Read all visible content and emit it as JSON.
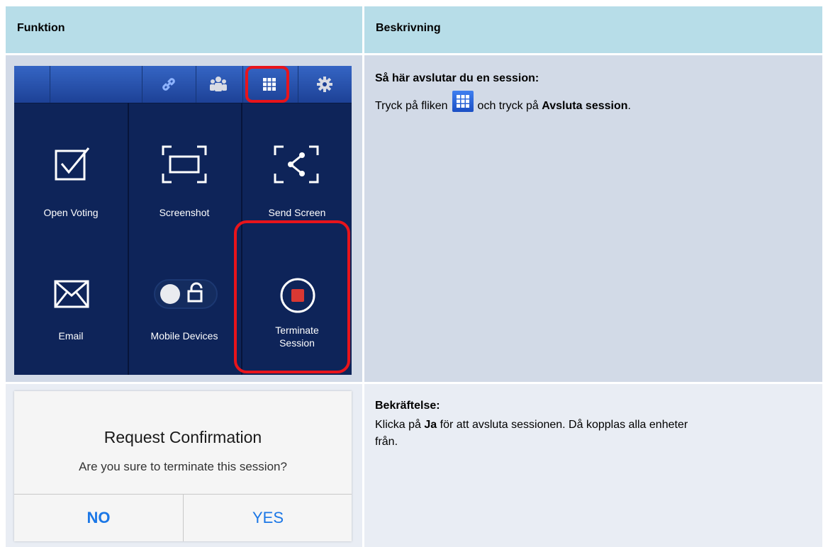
{
  "table": {
    "header": {
      "col1": "Funktion",
      "col2": "Beskrivning"
    }
  },
  "row1": {
    "menu": {
      "toolbar_icons": [
        "link-icon",
        "people-icon",
        "grid-icon",
        "gear-icon"
      ],
      "tiles": [
        {
          "label": "Open Voting",
          "icon": "checkbox-icon"
        },
        {
          "label": "Screenshot",
          "icon": "screenshot-icon"
        },
        {
          "label": "Send Screen",
          "icon": "share-icon"
        },
        {
          "label": "Email",
          "icon": "envelope-icon"
        },
        {
          "label": "Mobile Devices",
          "icon": "toggle-lock-icon"
        },
        {
          "label_line1": "Terminate",
          "label_line2": "Session",
          "icon": "stop-icon"
        }
      ],
      "highlight_color": "#e8141b"
    },
    "heading": "Så här avslutar du en session:",
    "text_before": "Tryck på fliken",
    "text_middle": "och tryck på",
    "text_bold": "Avsluta session",
    "text_end": "."
  },
  "row2": {
    "dialog": {
      "title": "Request Confirmation",
      "message": "Are you sure to terminate this session?",
      "no_label": "NO",
      "yes_label": "YES"
    },
    "heading": "Bekräftelse:",
    "line1_before": "Klicka på",
    "line1_bold": "Ja",
    "line1_after": "för att avsluta sessionen. Då kopplas alla enheter",
    "line2": "från."
  },
  "colors": {
    "header_bg": "#b7dde8",
    "row1_bg": "#d2dae7",
    "row2_bg": "#e9edf4",
    "menu_bg": "#0e2459",
    "ios_blue": "#1b77e6"
  }
}
